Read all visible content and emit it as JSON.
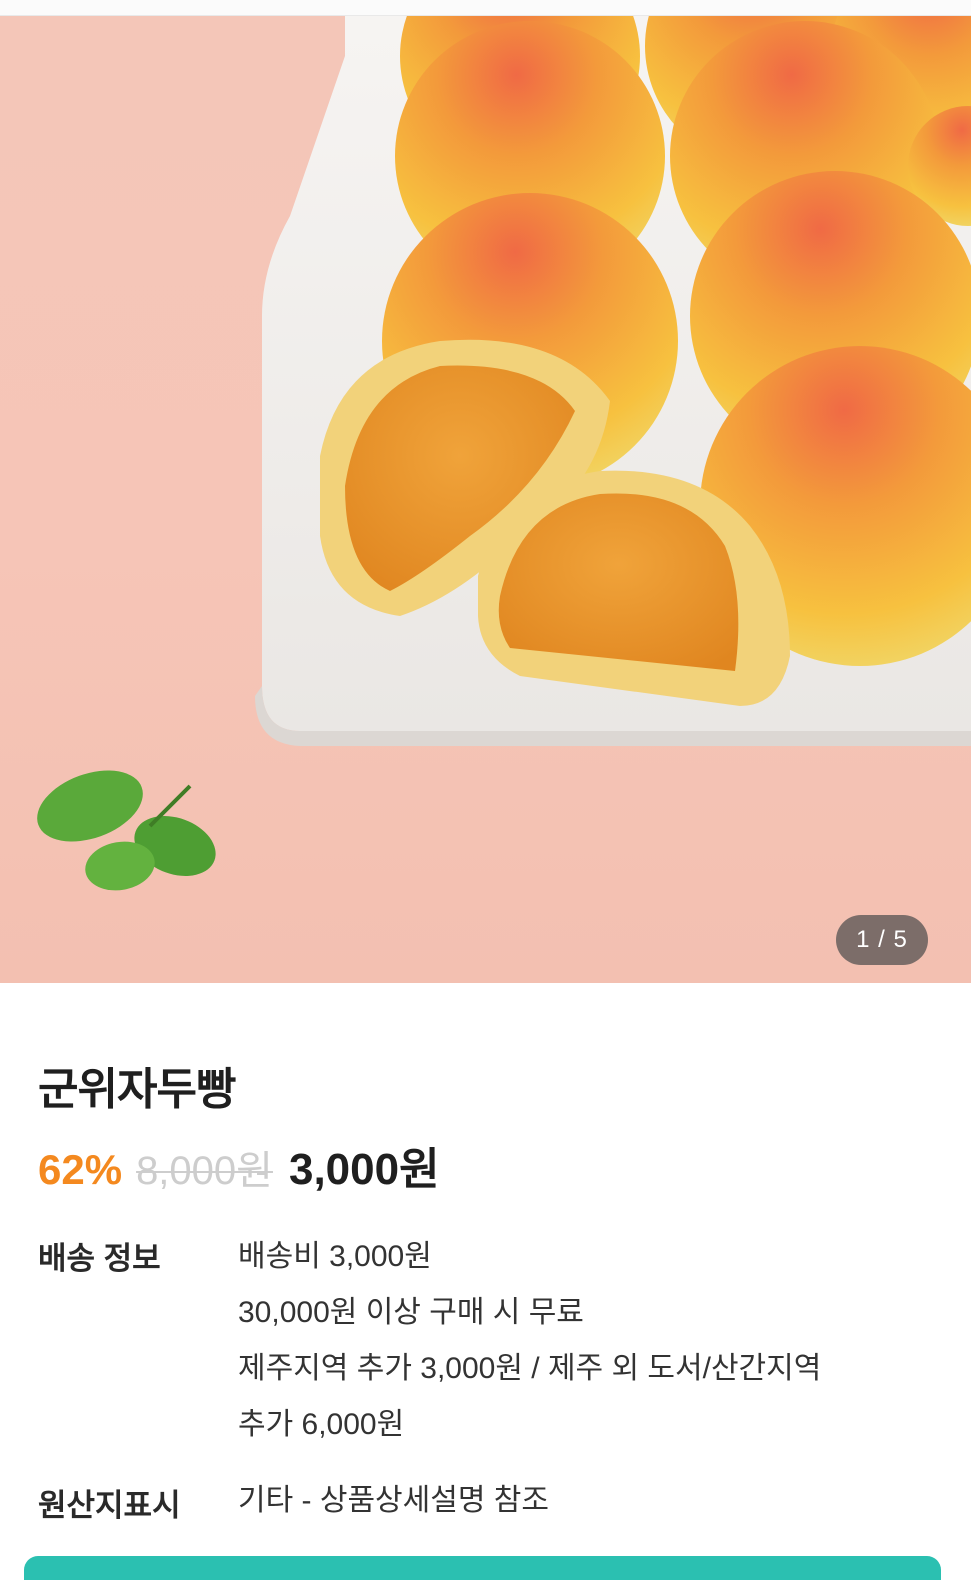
{
  "gallery": {
    "current": "1",
    "total": "5",
    "counter_text": "1 / 5"
  },
  "product": {
    "name": "군위자두빵",
    "discount": "62%",
    "original_price": "8,000원",
    "sale_price": "3,000원"
  },
  "details": {
    "shipping_label": "배송 정보",
    "shipping_lines": [
      "배송비 3,000원",
      "30,000원 이상 구매 시 무료",
      "제주지역 추가 3,000원 / 제주 외 도서/산간지역",
      "추가 6,000원"
    ],
    "origin_label": "원산지표시",
    "origin_value": "기타 - 상품상세설명 참조"
  },
  "colors": {
    "discount": "#f4891f",
    "cta": "#2bc0b1",
    "background_photo": "#f4c6b8"
  }
}
